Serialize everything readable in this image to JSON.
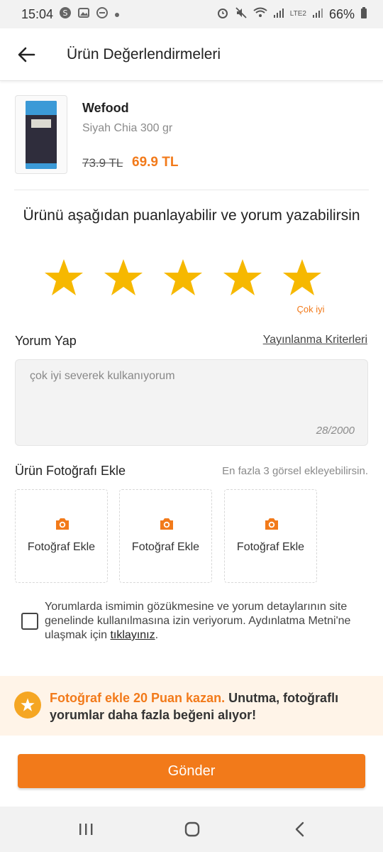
{
  "status_bar": {
    "time": "15:04",
    "battery": "66%",
    "network_label": "LTE2"
  },
  "header": {
    "title": "Ürün Değerlendirmeleri"
  },
  "product": {
    "brand": "Wefood",
    "name": "Siyah Chia 300 gr",
    "old_price": "73.9 TL",
    "new_price": "69.9 TL"
  },
  "rating": {
    "prompt": "Ürünü aşağıdan puanlayabilir ve yorum yazabilirsin",
    "value": 5,
    "max": 5,
    "label": "Çok iyi",
    "star_color": "#f6b800"
  },
  "comment": {
    "title": "Yorum Yap",
    "criteria_link": "Yayınlanma Kriterleri",
    "text": "çok iyi severek kulkanıyorum",
    "counter": "28/2000"
  },
  "photos": {
    "title": "Ürün Fotoğrafı Ekle",
    "hint": "En fazla 3 görsel ekleyebilirsin.",
    "slots": [
      {
        "label": "Fotoğraf Ekle",
        "icon": "camera-icon"
      },
      {
        "label": "Fotoğraf Ekle",
        "icon": "camera-icon"
      },
      {
        "label": "Fotoğraf Ekle",
        "icon": "camera-icon"
      }
    ]
  },
  "consent": {
    "text": "Yorumlarda ismimin gözükmesine ve yorum detaylarının site genelinde kullanılmasına izin veriyorum. Aydınlatma Metni'ne ulaşmak için ",
    "link": "tıklayınız",
    "suffix": ".",
    "checked": false
  },
  "banner": {
    "highlight": "Fotoğraf ekle 20 Puan kazan.",
    "text": " Unutma, fotoğraflı yorumlar daha fazla beğeni alıyor!"
  },
  "submit": {
    "label": "Gönder"
  },
  "colors": {
    "accent": "#f27a1a",
    "banner_bg": "#fff4e8"
  }
}
